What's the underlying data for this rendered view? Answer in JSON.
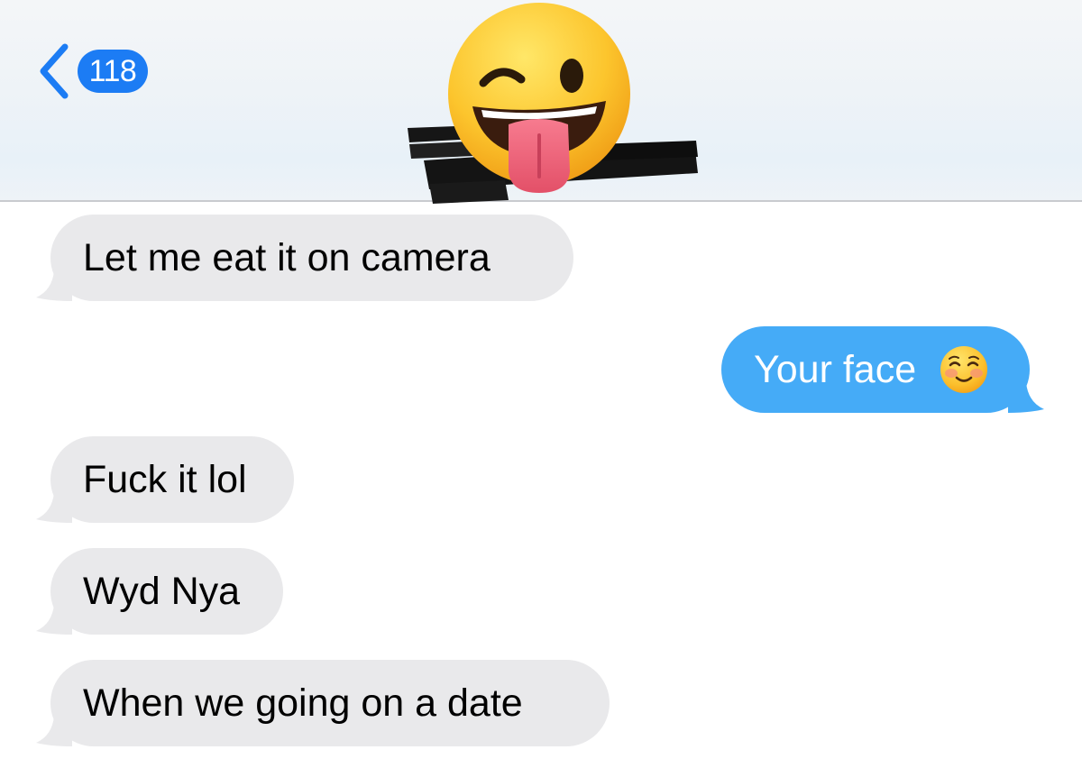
{
  "header": {
    "unread_count": "118",
    "contact_avatar": "winking-tongue-emoji"
  },
  "messages": [
    {
      "direction": "received",
      "text": "Let me eat it on camera"
    },
    {
      "direction": "sent",
      "text": "Your face",
      "emoji": "smiling-blush-emoji"
    },
    {
      "direction": "received",
      "text": "Fuck it lol"
    },
    {
      "direction": "received",
      "text": "Wyd Nya"
    },
    {
      "direction": "received",
      "text": "When we going on a date"
    }
  ],
  "colors": {
    "received_bubble": "#e9e9eb",
    "sent_bubble": "#45abf7",
    "accent": "#1c7cf4"
  }
}
